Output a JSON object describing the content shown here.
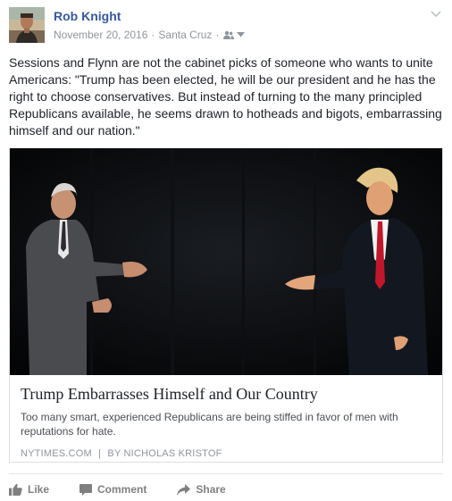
{
  "post": {
    "author": "Rob Knight",
    "date": "November 20, 2016",
    "location": "Santa Cruz",
    "separator": "·",
    "audience_icon": "friends-icon",
    "text": "Sessions and Flynn are not the cabinet picks of someone who wants to unite Americans: \"Trump has been elected, he will be our president and he has the right to choose conservatives. But instead of turning to the many principled Republicans available, he seems drawn to hotheads and bigots, embarrassing himself and our nation.\""
  },
  "link": {
    "title": "Trump Embarrasses Himself and Our Country",
    "description": "Too many smart, experienced Republicans are being stiffed in favor of men with reputations for hate.",
    "source": "NYTIMES.COM",
    "source_separator": "|",
    "byline": "BY NICHOLAS KRISTOF"
  },
  "actions": {
    "like": "Like",
    "comment": "Comment",
    "share": "Share"
  },
  "colors": {
    "link_blue": "#365899",
    "meta_gray": "#90949c",
    "action_gray": "#7f7f7f",
    "border": "#dddfe2"
  }
}
